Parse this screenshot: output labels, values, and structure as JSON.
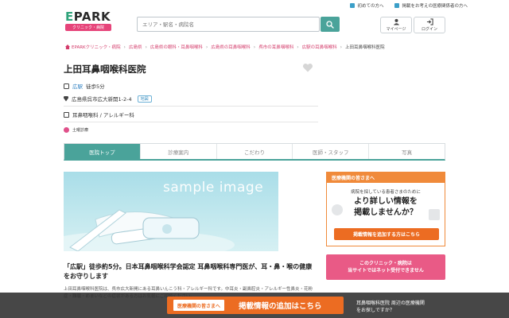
{
  "top_links": [
    {
      "label": "初めての方へ"
    },
    {
      "label": "掲載をお考えの医療関係者の方へ"
    }
  ],
  "logo": {
    "mark_e": "E",
    "mark_rest": "PARK",
    "sub": "クリニック・病院"
  },
  "search": {
    "placeholder": "エリア・駅名・病院名"
  },
  "header_buttons": {
    "mypage": "マイページ",
    "login": "ログイン"
  },
  "breadcrumb": [
    "EPARKクリニック・病院",
    "広島県",
    "広島県の眼科・耳鼻咽喉科",
    "広島県の耳鼻咽喉科",
    "呉市の耳鼻咽喉科",
    "広駅の耳鼻咽喉科",
    "上田耳鼻咽喉科医院"
  ],
  "clinic": {
    "name": "上田耳鼻咽喉科医院",
    "station": "広駅",
    "walk": "徒歩5分",
    "address": "広島県呉市広大新開1-2-4",
    "map_label": "地図",
    "departments": "耳鼻咽喉科 / アレルギー科",
    "saturday": "土曜診療"
  },
  "tabs": [
    {
      "label": "医院トップ",
      "active": true
    },
    {
      "label": "診療案内",
      "active": false
    },
    {
      "label": "こだわり",
      "active": false
    },
    {
      "label": "医師・スタッフ",
      "active": false
    },
    {
      "label": "写真",
      "active": false
    }
  ],
  "sample_image": {
    "text": "sample image"
  },
  "description": {
    "headline": "「広駅」徒歩約5分。日本耳鼻咽喉科学会認定 耳鼻咽喉科専門医が、耳・鼻・喉の健康をお守りします",
    "body": "上田耳鼻咽喉科医院は、呉市広大新開にある耳鼻いんこう科・アレルギー科です。中耳炎・副鼻腔炎・アレルギー性鼻炎・花粉症・難聴・めまいなどの症状がある方はお気軽にご相談ください。"
  },
  "ad": {
    "header": "医療機関の皆さまへ",
    "sub": "病院を探している患者さまのために",
    "big1": "より詳しい情報を",
    "big2": "掲載しませんか？",
    "button": "掲載情報を追加する方はこちら"
  },
  "no_booking": {
    "line1": "このクリニック・病院は",
    "line2": "当サイトではネット受付できません"
  },
  "bottom_bar": {
    "tag": "医療機関の皆さまへ",
    "button": "掲載情報の追加はこちら",
    "right1": "耳鼻咽喉科医院 周辺の医療機関",
    "right2": "をお探しですか？"
  },
  "colors": {
    "accent_teal": "#4aa39a",
    "pink": "#e95a86",
    "orange": "#ec6c22"
  }
}
